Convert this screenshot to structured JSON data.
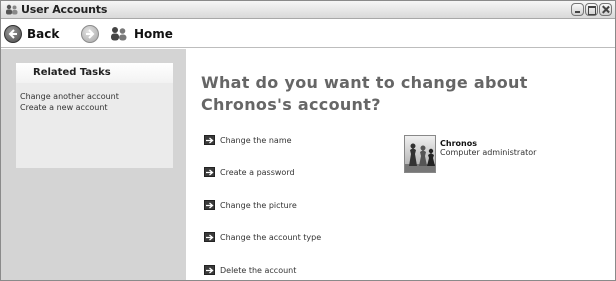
{
  "window": {
    "title": "User Accounts"
  },
  "toolbar": {
    "back_label": "Back",
    "home_label": "Home"
  },
  "sidebar": {
    "panel_title": "Related Tasks",
    "links": [
      "Change another account",
      "Create a new account"
    ]
  },
  "main": {
    "heading": "What do you want to change about Chronos's account?",
    "actions": [
      "Change the name",
      "Create a password",
      "Change the picture",
      "Change the account type",
      "Delete the account"
    ]
  },
  "account": {
    "name": "Chronos",
    "type": "Computer administrator"
  }
}
